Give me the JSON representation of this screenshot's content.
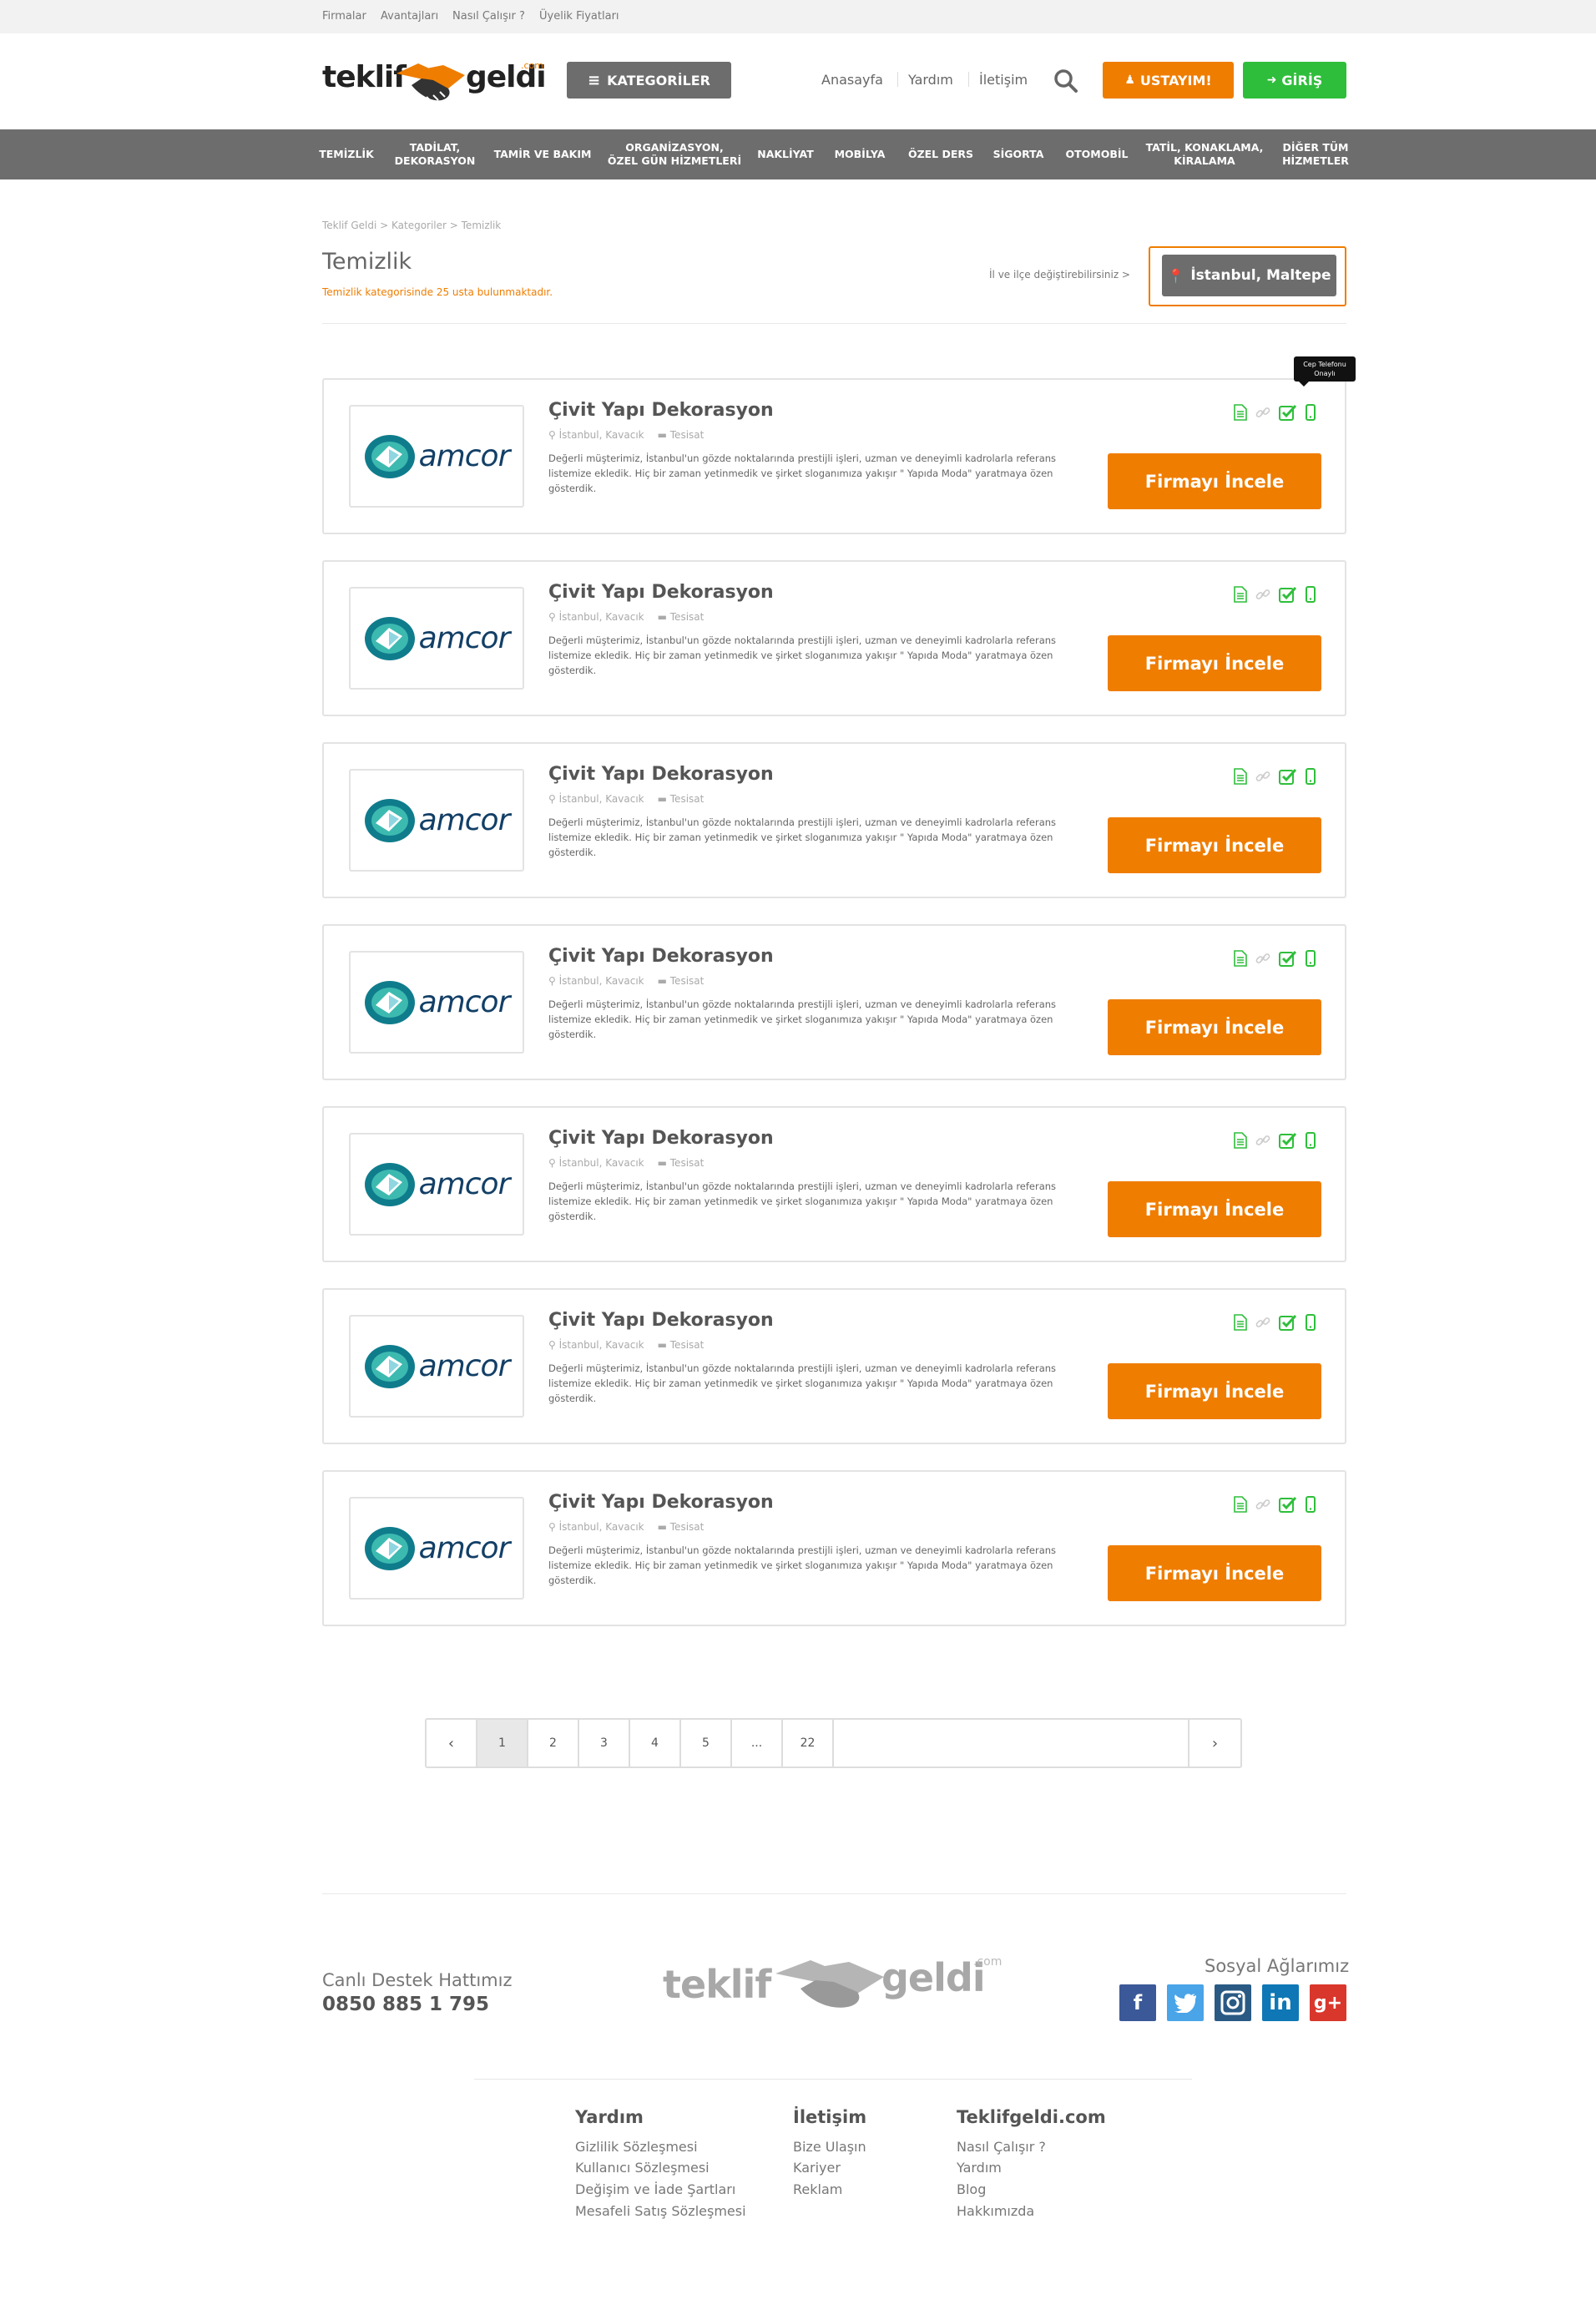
{
  "topbar": {
    "links": [
      "Firmalar",
      "Avantajları",
      "Nasıl Çalışır ?",
      "Üyelik Fiyatları"
    ]
  },
  "brand": {
    "part1": "teklif",
    "part2": "geldi",
    "suffix": ".com",
    "accent": "#ef7d00"
  },
  "header": {
    "categories_button": "KATEGORİLER",
    "nav": [
      "Anasayfa",
      "Yardım",
      "İletişim"
    ],
    "ustayim_button": "USTAYIM!",
    "giris_button": "GİRİŞ"
  },
  "category_bar": [
    "TEMİZLİK",
    "TADİLAT,\nDEKORASYON",
    "TAMİR VE BAKIM",
    "ORGANİZASYON,\nÖZEL GÜN HİZMETLERİ",
    "NAKLİYAT",
    "MOBİLYA",
    "ÖZEL DERS",
    "SİGORTA",
    "OTOMOBİL",
    "TATİL, KONAKLAMA,\nKİRALAMA",
    "DİĞER TÜM\nHİZMETLER"
  ],
  "breadcrumb": "Teklif Geldi > Kategoriler > Temizlik",
  "page": {
    "title": "Temizlik",
    "subtitle": "Temizlik kategorisinde 25 usta bulunmaktadır.",
    "location_hint": "İl ve ilçe değiştirebilirsiniz >",
    "location": "İstanbul, Maltepe"
  },
  "tooltip": "Cep Telefonu\nOnaylı",
  "listing": {
    "name": "Çivit Yapı Dekorasyon",
    "location": "İstanbul, Kavacık",
    "category": "Tesisat",
    "description": "Değerli müşterimiz, İstanbul'un gözde noktalarında prestijli işleri, uzman ve deneyimli kadrolarla referans listemize ekledik. Hiç bir zaman yetinmedik ve şirket sloganımıza yakışır \" Yapıda Moda\" yaratmaya özen gösterdik.",
    "button": "Firmayı İncele",
    "logo_text": "amcor"
  },
  "listings_count": 7,
  "pagination": {
    "prev": "‹",
    "pages": [
      "1",
      "2",
      "3",
      "4",
      "5",
      "...",
      "22"
    ],
    "next": "›",
    "active": "1"
  },
  "footer": {
    "support_label": "Canlı Destek Hattımız",
    "support_phone": "0850 885 1 795",
    "social_title": "Sosyal Ağlarımız",
    "social": [
      "facebook-icon",
      "twitter-icon",
      "instagram-icon",
      "linkedin-icon",
      "google-plus-icon"
    ],
    "cols": [
      {
        "title": "Yardım",
        "links": [
          "Gizlilik Sözleşmesi",
          "Kullanıcı Sözleşmesi",
          "Değişim ve İade Şartları",
          "Mesafeli Satış Sözleşmesi"
        ]
      },
      {
        "title": "İletişim",
        "links": [
          "Bize Ulaşın",
          "Kariyer",
          "Reklam"
        ]
      },
      {
        "title": "Teklifgeldi.com",
        "links": [
          "Nasıl Çalışır ?",
          "Yardım",
          "Blog",
          "Hakkımızda"
        ]
      }
    ]
  }
}
